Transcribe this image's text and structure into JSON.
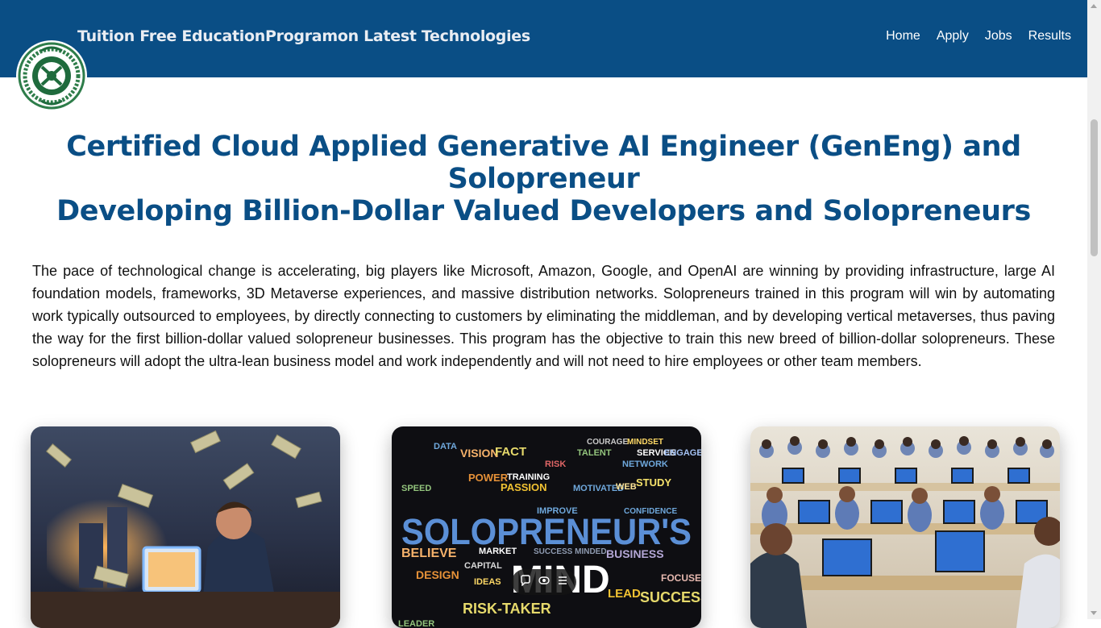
{
  "header": {
    "title": "Tuition Free EducationProgramon Latest Technologies",
    "logo_icon": "emblem-logo-icon",
    "nav": [
      "Home",
      "Apply",
      "Jobs",
      "Results"
    ],
    "background": "#0a4e85"
  },
  "hero": {
    "line1": "Certified Cloud Applied Generative AI Engineer (GenEng) and Solopreneur",
    "line2": "Developing Billion-Dollar Valued Developers and Solopreneurs",
    "color": "#0a4e85"
  },
  "intro": "The pace of technological change is accelerating, big players like Microsoft, Amazon, Google, and OpenAI are winning by providing infrastructure, large AI foundation models, frameworks, 3D Metaverse experiences, and massive distribution networks. Solopreneurs trained in this program will win by automating work typically outsourced to employees, by directly connecting to customers by eliminating the middleman, and by developing vertical metaverses, thus paving the way for the first billion-dollar valued solopreneur businesses. This program has the objective to train this new breed of billion-dollar solopreneurs. These solopreneurs will adopt the ultra-lean business model and work independently and will not need to hire employees or other team members.",
  "cards": [
    {
      "image": "businessman-at-computer-with-flying-money"
    },
    {
      "image": "solopreneur-mind-word-cloud",
      "big_words": [
        "SOLOPRENEUR'S",
        "MIND"
      ],
      "words": [
        "DATA",
        "VISION",
        "FACT",
        "TALENT",
        "POWER",
        "TRAINING",
        "PASSION",
        "STUDY",
        "COURAGE",
        "MINDSET",
        "SERVICE",
        "ENGAGE",
        "NETWORK",
        "RISK",
        "SPEED",
        "MOTIVATED",
        "WEB",
        "CONFIDENCE",
        "BELIEVE",
        "MARKET",
        "BUSINESS",
        "DESIGN",
        "CAPITAL",
        "FOCUSED",
        "LEAD",
        "IDEAS",
        "RISK-TAKER",
        "SUCCESS",
        "IMPROVE",
        "LEADER",
        "SUCCESS MINDED"
      ]
    },
    {
      "image": "students-in-computer-lab"
    }
  ],
  "overlay_toolbar": {
    "icons": [
      "comment-icon",
      "eye-icon",
      "menu-icon"
    ]
  }
}
